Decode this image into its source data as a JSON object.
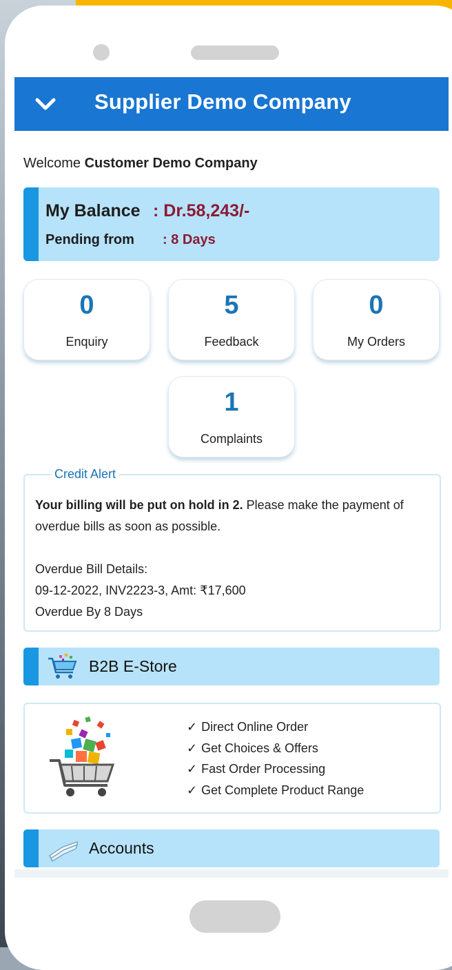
{
  "header": {
    "title": "Supplier Demo Company"
  },
  "welcome": {
    "prefix": "Welcome",
    "company": "Customer Demo Company"
  },
  "balance": {
    "label": "My Balance",
    "value": ": Dr.58,243/-",
    "pending_label": "Pending from",
    "pending_value": ": 8 Days",
    "value_color": "#8b1b35"
  },
  "tiles": [
    {
      "count": "0",
      "label": "Enquiry"
    },
    {
      "count": "5",
      "label": "Feedback"
    },
    {
      "count": "0",
      "label": "My Orders"
    },
    {
      "count": "1",
      "label": "Complaints"
    }
  ],
  "credit_alert": {
    "title": "Credit Alert",
    "bold_text": "Your billing will be put on hold in 2.",
    "text": " Please make the payment of overdue bills as soon as possible.",
    "details_heading": "Overdue Bill Details:",
    "bill_line": "09-12-2022, INV2223-3, Amt: ₹17,600",
    "overdue_line": "Overdue By 8 Days"
  },
  "b2b_store": {
    "title": "B2B E-Store",
    "icon": "cart-icon",
    "features": [
      "Direct Online Order",
      "Get Choices & Offers",
      "Fast Order Processing",
      "Get Complete Product Range"
    ],
    "check_mark": "✓"
  },
  "accounts": {
    "title": "Accounts",
    "icon": "book-icon"
  },
  "colors": {
    "appbar": "#1976d2",
    "accent": "#1997e0",
    "section_bg": "#b7e3fa",
    "count_color": "#1a75b7"
  }
}
